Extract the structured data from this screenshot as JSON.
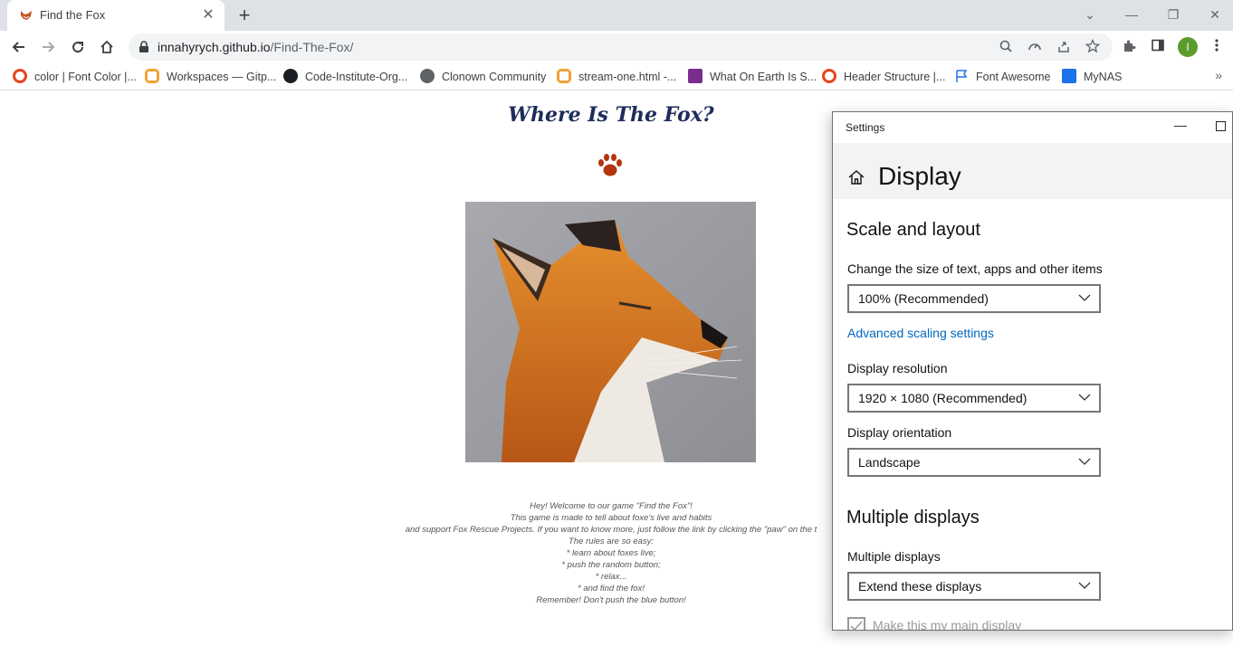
{
  "browser": {
    "tab": {
      "title": "Find the Fox",
      "close": "✕"
    },
    "new_tab": "+",
    "window_controls": {
      "minimize": "—",
      "restore": "❐",
      "close": "✕",
      "tab_search": "⌄"
    },
    "address": {
      "host": "innahyrych.github.io",
      "path": "/Find-The-Fox/"
    },
    "profile_initial": "I",
    "bookmarks": [
      {
        "label": "color | Font Color |...",
        "icon": "circle-orange-icon",
        "color": "#e8471c"
      },
      {
        "label": "Workspaces — Gitp...",
        "icon": "gitpod-icon",
        "color": "#f2a33a"
      },
      {
        "label": "Code-Institute-Org...",
        "icon": "github-icon",
        "color": "#1b1f23"
      },
      {
        "label": "Clonown Community",
        "icon": "globe-icon",
        "color": "#5f6368"
      },
      {
        "label": "stream-one.html -...",
        "icon": "gitpod-icon",
        "color": "#f2a33a"
      },
      {
        "label": "What On Earth Is S...",
        "icon": "hackernoon-icon",
        "color": "#7b2d8e"
      },
      {
        "label": "Header Structure |...",
        "icon": "circle-orange-icon",
        "color": "#e8471c"
      },
      {
        "label": "Font Awesome",
        "icon": "flag-icon",
        "color": "#1a73e8"
      },
      {
        "label": "MyNAS",
        "icon": "dsm-icon",
        "color": "#1a73e8"
      }
    ],
    "bookmarks_more": "»"
  },
  "page": {
    "title": "Where Is The Fox?",
    "paw_color": "#b5340e",
    "intro_lines": [
      "Hey! Welcome to our game \"Find the Fox\"!",
      "This game is made to tell about foxe's live and habits",
      "and support Fox Rescue Projects. If you want to know more, just follow the link by clicking the \"paw\" on the t",
      "The rules are so easy:",
      "* learn about foxes live;",
      "* push the random button;",
      "* relax...",
      "* and find the fox!",
      "Remember! Don't push the blue button!"
    ]
  },
  "settings": {
    "window_title": "Settings",
    "minimize": "—",
    "heading": "Display",
    "scale_section": "Scale and layout",
    "scale_label": "Change the size of text, apps and other items",
    "scale_value": "100% (Recommended)",
    "advanced_link": "Advanced scaling settings",
    "resolution_label": "Display resolution",
    "resolution_value": "1920 × 1080 (Recommended)",
    "orientation_label": "Display orientation",
    "orientation_value": "Landscape",
    "multi_section": "Multiple displays",
    "multi_label": "Multiple displays",
    "multi_value": "Extend these displays",
    "main_display_label": "Make this my main display"
  }
}
